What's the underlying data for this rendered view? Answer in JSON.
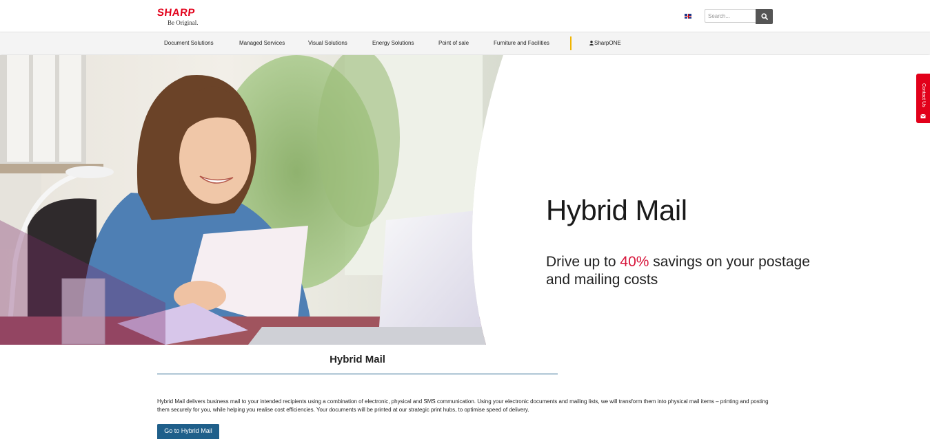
{
  "header": {
    "logo_text": "SHARP",
    "logo_tagline": "Be Original.",
    "language_flag": "uk-flag-icon",
    "search_placeholder": "Search...",
    "search_icon": "search-icon"
  },
  "nav": {
    "items": [
      {
        "label": "Document Solutions"
      },
      {
        "label": "Managed Services"
      },
      {
        "label": "Visual Solutions"
      },
      {
        "label": "Energy Solutions"
      },
      {
        "label": "Point of sale"
      },
      {
        "label": "Furniture and Facilities"
      }
    ],
    "account_label": "SharpONE",
    "account_icon": "user-icon",
    "separator_color": "#f0b400"
  },
  "hero": {
    "title": "Hybrid Mail",
    "subtitle_prefix": "Drive up to ",
    "subtitle_highlight": "40%",
    "subtitle_suffix": " savings on your postage and mailing costs",
    "accent_color": "#d7143a",
    "image": "woman-reading-letter-at-laptop"
  },
  "contact_tab": {
    "label": "Contact Us",
    "icon": "envelope-icon",
    "color": "#e2001a"
  },
  "content": {
    "section_title": "Hybrid Mail",
    "body": "Hybrid Mail delivers business mail to your intended recipients using a combination of electronic, physical and SMS communication. Using your electronic documents and mailing lists, we will transform them into physical mail items – printing and posting them securely for you, while helping you realise cost efficiencies. Your documents will be printed at our strategic print hubs, to optimise speed of delivery.",
    "cta_label": "Go to Hybrid Mail",
    "cta_color": "#1f5f8a"
  }
}
